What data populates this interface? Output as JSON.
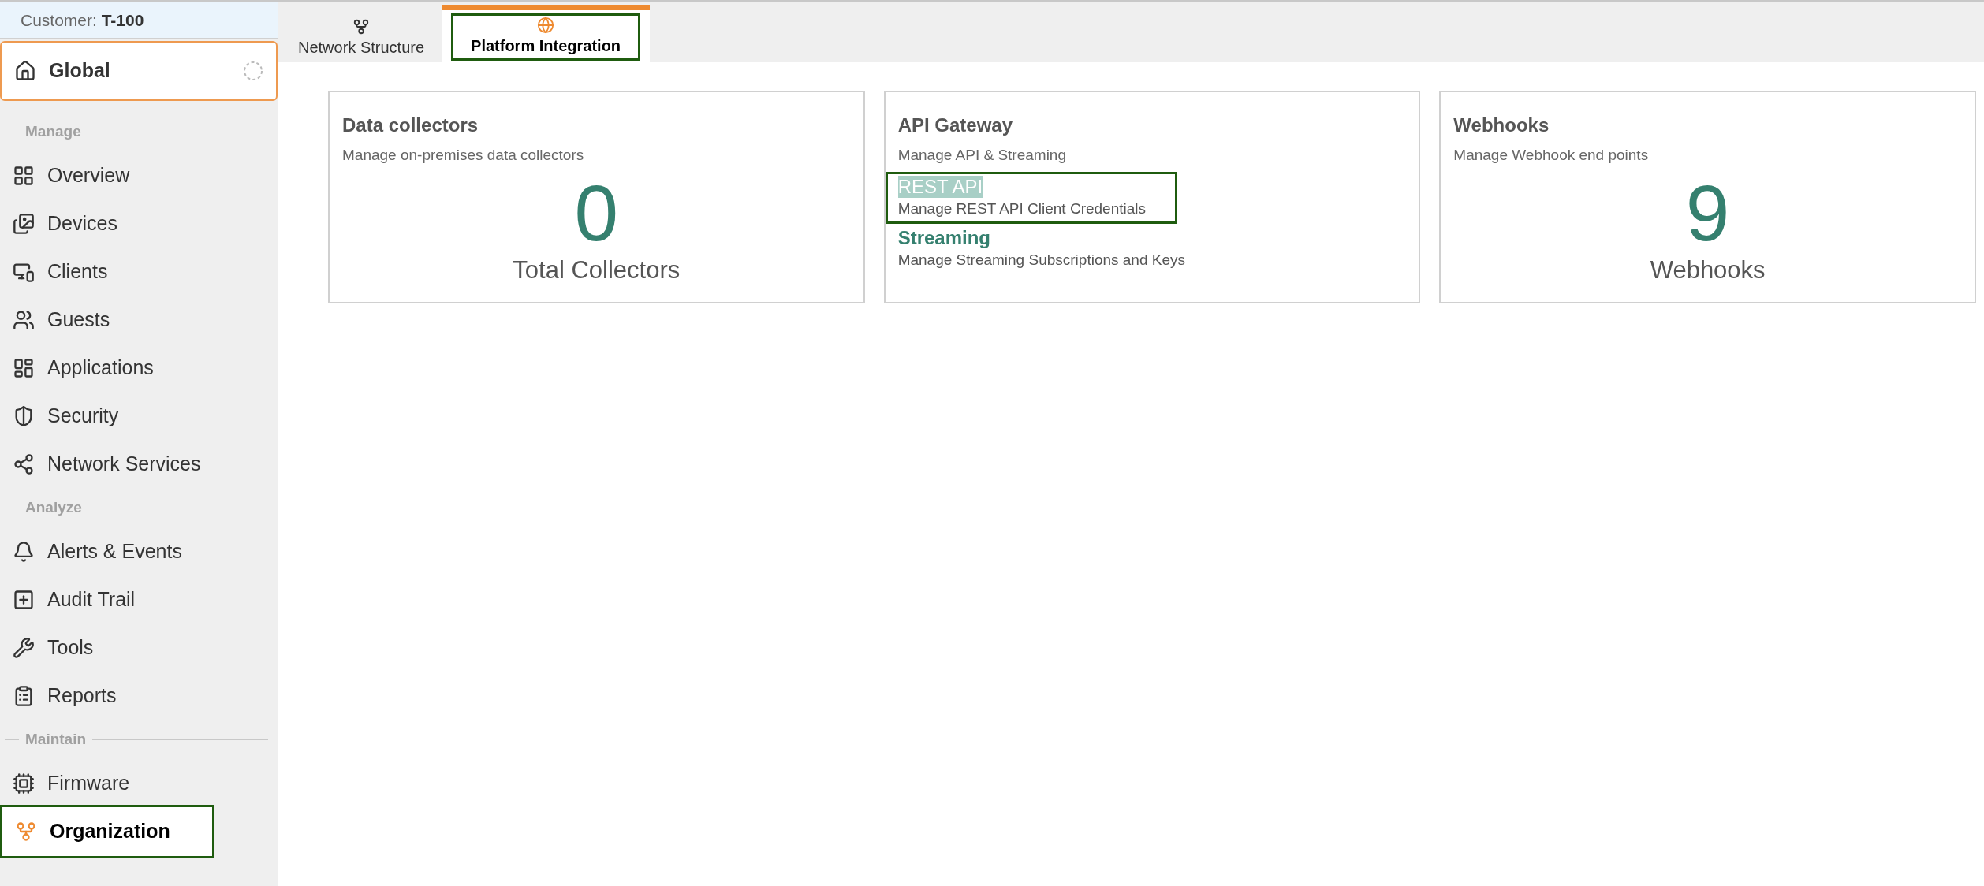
{
  "customer": {
    "label": "Customer:",
    "value": "T-100"
  },
  "scope": {
    "label": "Global",
    "loading": true
  },
  "sidebar": {
    "items": [
      {
        "kind": "header",
        "label": "Manage"
      },
      {
        "kind": "item",
        "label": "Overview",
        "selected": false
      },
      {
        "kind": "item",
        "label": "Devices",
        "selected": false
      },
      {
        "kind": "item",
        "label": "Clients",
        "selected": false
      },
      {
        "kind": "item",
        "label": "Guests",
        "selected": false
      },
      {
        "kind": "item",
        "label": "Applications",
        "selected": false
      },
      {
        "kind": "item",
        "label": "Security",
        "selected": false
      },
      {
        "kind": "item",
        "label": "Network Services",
        "selected": false
      },
      {
        "kind": "header",
        "label": "Analyze"
      },
      {
        "kind": "item",
        "label": "Alerts & Events",
        "selected": false
      },
      {
        "kind": "item",
        "label": "Audit Trail",
        "selected": false
      },
      {
        "kind": "item",
        "label": "Tools",
        "selected": false
      },
      {
        "kind": "item",
        "label": "Reports",
        "selected": false
      },
      {
        "kind": "header",
        "label": "Maintain"
      },
      {
        "kind": "item",
        "label": "Firmware",
        "selected": false
      },
      {
        "kind": "item",
        "label": "Organization",
        "selected": true
      }
    ]
  },
  "tabs": [
    {
      "label": "Network Structure",
      "selected": false
    },
    {
      "label": "Platform Integration",
      "selected": true
    }
  ],
  "cards": [
    {
      "kind": "count",
      "title": "Data collectors",
      "subtitle": "Manage on-premises data collectors",
      "count": "0",
      "count_label": "Total Collectors"
    },
    {
      "kind": "links",
      "title": "API Gateway",
      "subtitle": "Manage API & Streaming",
      "links": [
        {
          "label": "REST API",
          "description": "Manage REST API Client Credentials",
          "highlighted": true
        },
        {
          "label": "Streaming",
          "description": "Manage Streaming Subscriptions and Keys",
          "highlighted": false
        }
      ]
    },
    {
      "kind": "count",
      "title": "Webhooks",
      "subtitle": "Manage Webhook end points",
      "count": "9",
      "count_label": "Webhooks"
    }
  ]
}
